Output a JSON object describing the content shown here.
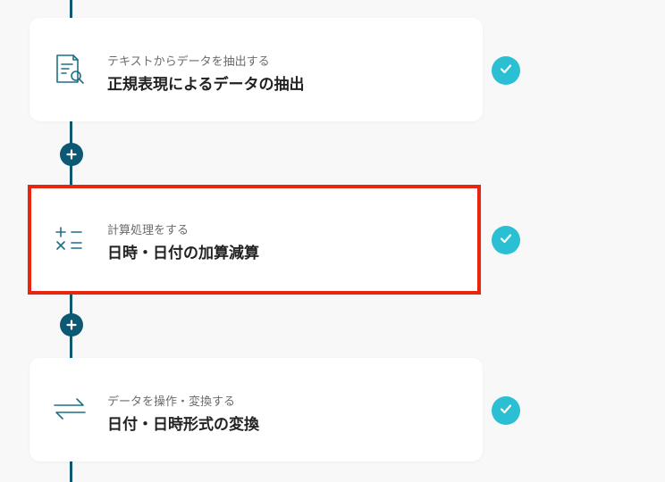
{
  "colors": {
    "connector_line": "#0d5873",
    "check_badge": "#2bbfd3",
    "selection_border": "#e8260f",
    "icon_stroke": "#1f6f86"
  },
  "steps": [
    {
      "subtitle": "テキストからデータを抽出する",
      "title": "正規表現によるデータの抽出",
      "icon": "document-search-icon",
      "status": "completed",
      "selected": false
    },
    {
      "subtitle": "計算処理をする",
      "title": "日時・日付の加算減算",
      "icon": "calculator-operators-icon",
      "status": "completed",
      "selected": true
    },
    {
      "subtitle": "データを操作・変換する",
      "title": "日付・日時形式の変換",
      "icon": "transform-arrows-icon",
      "status": "completed",
      "selected": false
    }
  ],
  "add_buttons": [
    {
      "icon": "plus-icon"
    },
    {
      "icon": "plus-icon"
    }
  ]
}
